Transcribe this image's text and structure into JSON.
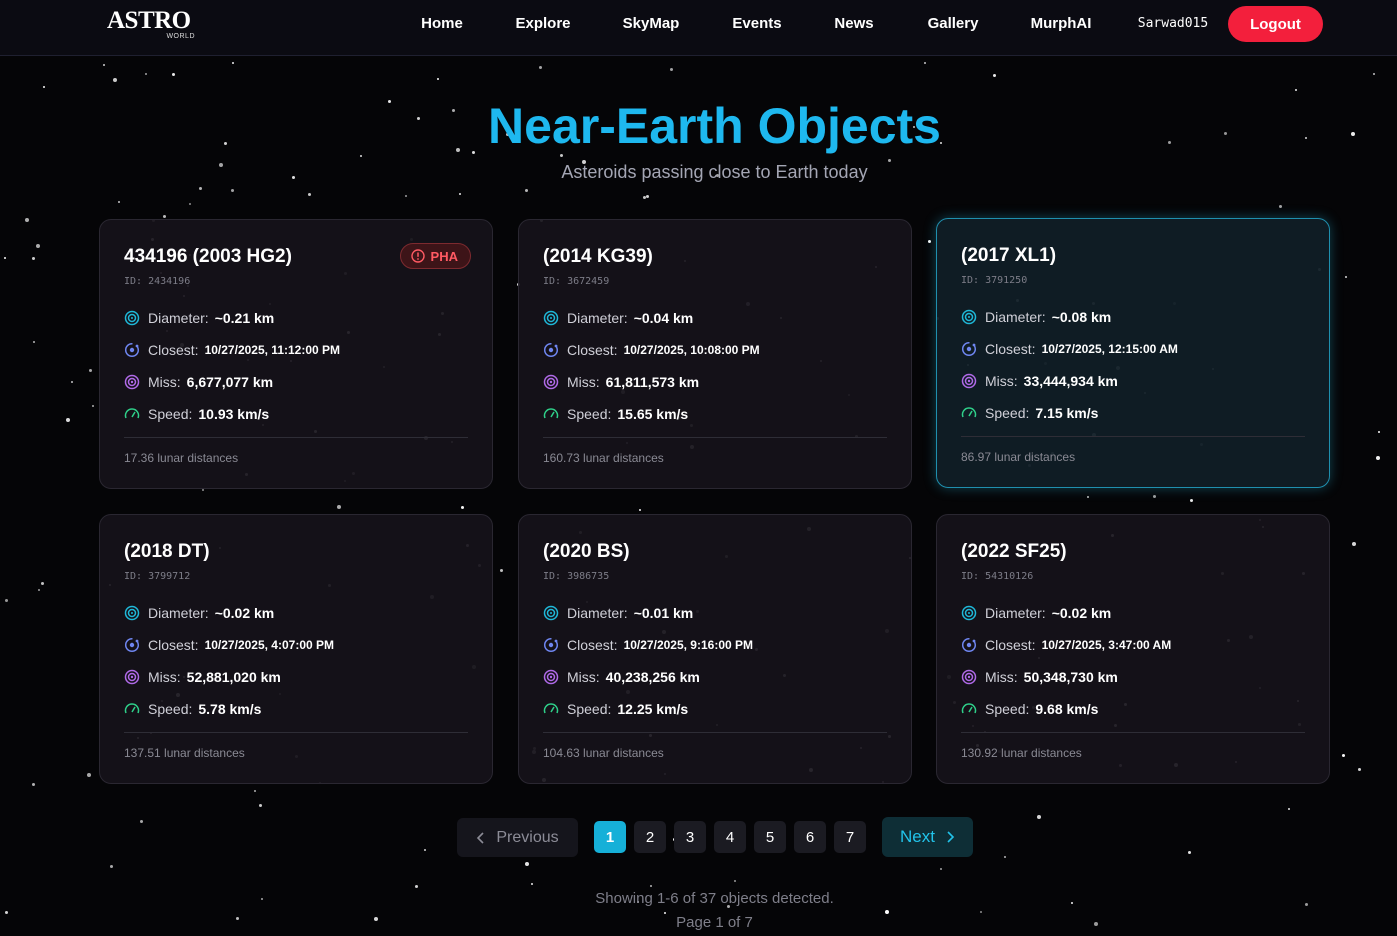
{
  "nav": {
    "logo_main": "ASTRO",
    "logo_sub": "WORLD",
    "links": [
      "Home",
      "Explore",
      "SkyMap",
      "Events",
      "News",
      "Gallery",
      "MurphAI"
    ],
    "username": "Sarwad015",
    "logout_label": "Logout"
  },
  "header": {
    "title": "Near-Earth Objects",
    "subtitle": "Asteroids passing close to Earth today"
  },
  "labels": {
    "diameter": "Diameter:",
    "closest": "Closest:",
    "miss": "Miss:",
    "speed": "Speed:",
    "pha_badge": "PHA"
  },
  "objects": [
    {
      "name": "434196 (2003 HG2)",
      "id_text": "ID: 2434196",
      "pha": true,
      "diameter": "~0.21 km",
      "closest": "10/27/2025, 11:12:00 PM",
      "miss": "6,677,077 km",
      "speed": "10.93 km/s",
      "lunar": "17.36 lunar distances"
    },
    {
      "name": "(2014 KG39)",
      "id_text": "ID: 3672459",
      "pha": false,
      "diameter": "~0.04 km",
      "closest": "10/27/2025, 10:08:00 PM",
      "miss": "61,811,573 km",
      "speed": "15.65 km/s",
      "lunar": "160.73 lunar distances"
    },
    {
      "name": "(2017 XL1)",
      "id_text": "ID: 3791250",
      "pha": false,
      "diameter": "~0.08 km",
      "closest": "10/27/2025, 12:15:00 AM",
      "miss": "33,444,934 km",
      "speed": "7.15 km/s",
      "lunar": "86.97 lunar distances"
    },
    {
      "name": "(2018 DT)",
      "id_text": "ID: 3799712",
      "pha": false,
      "diameter": "~0.02 km",
      "closest": "10/27/2025, 4:07:00 PM",
      "miss": "52,881,020 km",
      "speed": "5.78 km/s",
      "lunar": "137.51 lunar distances"
    },
    {
      "name": "(2020 BS)",
      "id_text": "ID: 3986735",
      "pha": false,
      "diameter": "~0.01 km",
      "closest": "10/27/2025, 9:16:00 PM",
      "miss": "40,238,256 km",
      "speed": "12.25 km/s",
      "lunar": "104.63 lunar distances"
    },
    {
      "name": "(2022 SF25)",
      "id_text": "ID: 54310126",
      "pha": false,
      "diameter": "~0.02 km",
      "closest": "10/27/2025, 3:47:00 AM",
      "miss": "50,348,730 km",
      "speed": "9.68 km/s",
      "lunar": "130.92 lunar distances"
    }
  ],
  "pagination": {
    "prev_label": "Previous",
    "next_label": "Next",
    "pages": [
      "1",
      "2",
      "3",
      "4",
      "5",
      "6",
      "7"
    ],
    "current_page": 1,
    "summary": "Showing 1-6 of 37 objects detected.",
    "page_of": "Page 1 of 7"
  },
  "colors": {
    "accent": "#1eb8ef",
    "logout": "#f31f3c",
    "pha": "#ff5a63",
    "diameter_icon": "#1fb8d8",
    "closest_icon": "#6f86f0",
    "miss_icon": "#b06ae8",
    "speed_icon": "#2fd08a"
  }
}
